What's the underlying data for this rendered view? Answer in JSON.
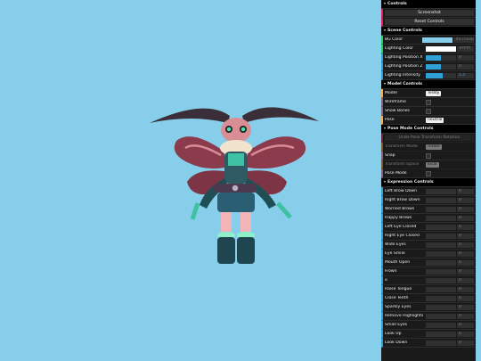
{
  "colors": {
    "background": "#87ceeb",
    "panel": "#1a1a1a"
  },
  "gui": {
    "controls_title": "Controls",
    "screenshot_label": "Screenshot",
    "reset_label": "Reset Controls",
    "scene": {
      "title": "Scene Controls",
      "bg_color": {
        "label": "BG Color",
        "value": "#87ceeb",
        "swatch": "#87ceeb"
      },
      "lighting_color": {
        "label": "Lighting Color",
        "value": "#ffffff",
        "swatch": "#ffffff"
      },
      "light_x": {
        "label": "Lighting Position X",
        "value": "0",
        "fraction": 0.5
      },
      "light_z": {
        "label": "Lighting Position Z",
        "value": "0",
        "fraction": 0.5
      },
      "intensity": {
        "label": "Lighting Intensity",
        "value": "5.5",
        "fraction": 0.55
      }
    },
    "model": {
      "title": "Model Controls",
      "model": {
        "label": "Model",
        "value": "Teddy"
      },
      "wireframe": {
        "label": "Wireframe"
      },
      "show_bones": {
        "label": "Show Bones"
      },
      "pose": {
        "label": "Pose",
        "value": "neutral"
      }
    },
    "pose_mode": {
      "title": "Pose Mode Controls",
      "undo_label": "Undo Pose Transform Rotation",
      "transform_mode": {
        "label": "Transform Mode",
        "value": "rotate"
      },
      "snap": {
        "label": "Snap"
      },
      "transform_space": {
        "label": "Transform Space",
        "value": "local"
      },
      "pose_mode": {
        "label": "Pose Mode"
      }
    },
    "expressions": {
      "title": "Expression Controls",
      "items": [
        {
          "label": "Left Brow Down",
          "value": "0"
        },
        {
          "label": "Right Brow Down",
          "value": "0"
        },
        {
          "label": "Worried Brows",
          "value": "0"
        },
        {
          "label": "Happy Brows",
          "value": "0"
        },
        {
          "label": "Left Eye Closed",
          "value": "0"
        },
        {
          "label": "Right Eye Closed",
          "value": "0"
        },
        {
          "label": "Wide Eyes",
          "value": "0"
        },
        {
          "label": "Eye Smile",
          "value": "0"
        },
        {
          "label": "Mouth Open",
          "value": "0"
        },
        {
          "label": "Frown",
          "value": "0"
        },
        {
          "label": "o",
          "value": "0"
        },
        {
          "label": "Raise Tongue",
          "value": "0"
        },
        {
          "label": "Close Teeth",
          "value": "0"
        },
        {
          "label": "Sparkly Eyes",
          "value": "0"
        },
        {
          "label": "Remove Highlights",
          "value": "0"
        },
        {
          "label": "Small Eyes",
          "value": "0"
        },
        {
          "label": "Look Up",
          "value": "0"
        },
        {
          "label": "Look Down",
          "value": "0"
        }
      ]
    }
  }
}
